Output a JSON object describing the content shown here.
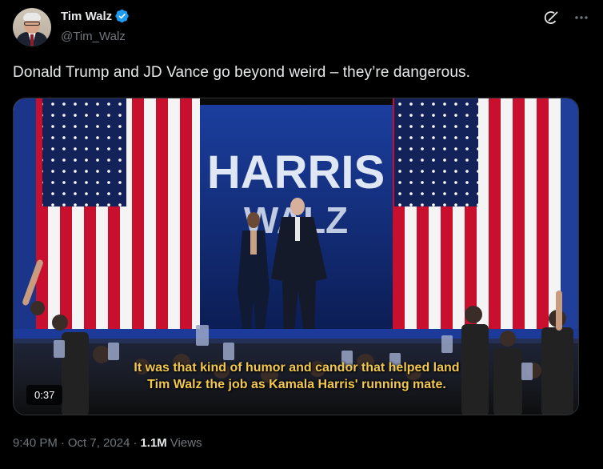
{
  "author": {
    "display_name": "Tim Walz",
    "handle": "@Tim_Walz",
    "verified": true
  },
  "post": {
    "text": "Donald Trump and JD Vance go beyond weird – they’re dangerous.",
    "media": {
      "sign_line1": "HARRIS",
      "sign_line2": "WALZ",
      "caption_line1": "It was that kind of humor and candor that helped land",
      "caption_line2": "Tim Walz the job as Kamala Harris' running mate.",
      "duration": "0:37"
    },
    "time": "9:40 PM",
    "date": "Oct 7, 2024",
    "views_count": "1.1M",
    "views_label": "Views",
    "separator": "·"
  },
  "icons": {
    "grok": "grok-icon",
    "more": "more-icon",
    "verified": "verified-badge-icon"
  },
  "colors": {
    "background": "#000000",
    "text_primary": "#e7e9ea",
    "text_secondary": "#71767b",
    "verified_blue": "#1d9bf0",
    "caption_yellow": "#f2c94c"
  }
}
